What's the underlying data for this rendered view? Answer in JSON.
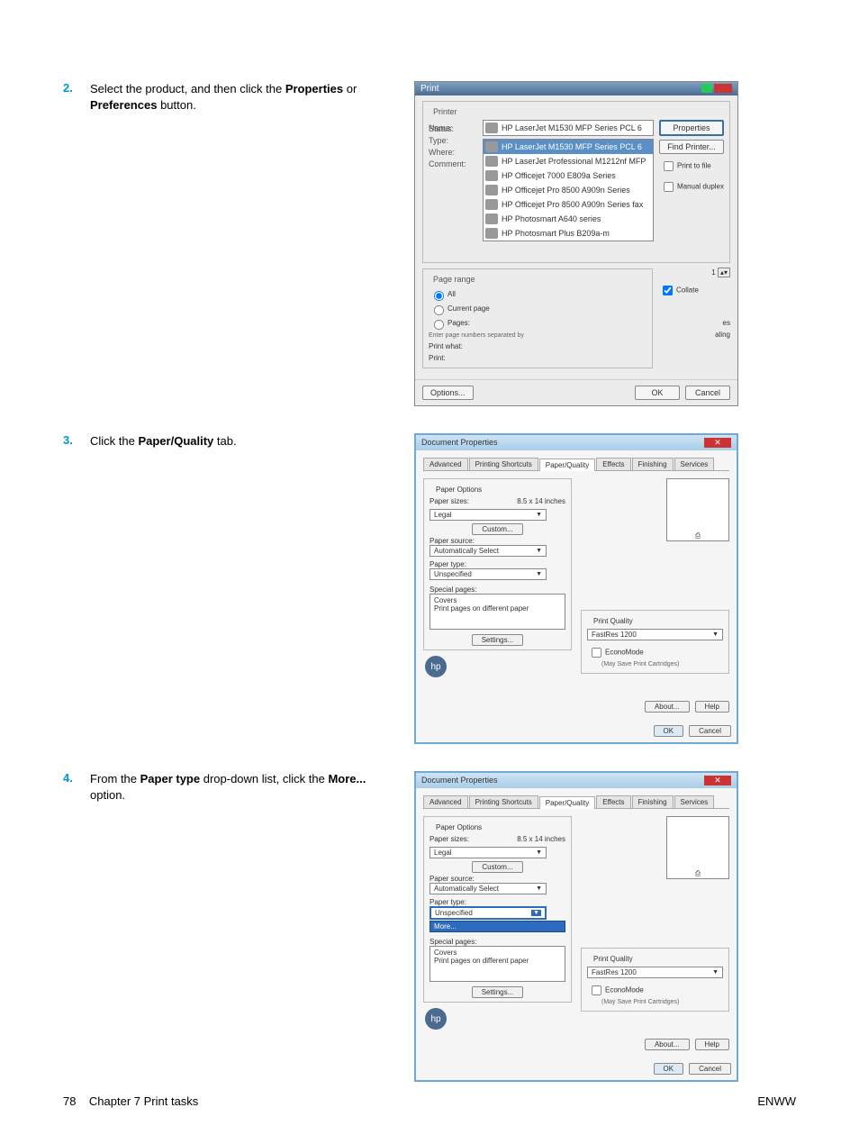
{
  "steps": {
    "s2": {
      "num": "2.",
      "text_pre": "Select the product, and then click the ",
      "bold1": "Properties",
      "mid": " or ",
      "bold2": "Preferences",
      "text_post": " button."
    },
    "s3": {
      "num": "3.",
      "text_pre": "Click the ",
      "bold1": "Paper/Quality",
      "text_post": " tab."
    },
    "s4": {
      "num": "4.",
      "text_pre": "From the ",
      "bold1": "Paper type",
      "mid": " drop-down list, click the ",
      "bold2": "More...",
      "text_post": " option."
    }
  },
  "print_dialog": {
    "title": "Print",
    "printer_group": "Printer",
    "name_label": "Name:",
    "status_label": "Status:",
    "type_label": "Type:",
    "where_label": "Where:",
    "comment_label": "Comment:",
    "printers": [
      "HP LaserJet M1530 MFP Series PCL 6",
      "HP LaserJet M1530 MFP Series PCL 6",
      "HP LaserJet Professional M1212nf MFP",
      "HP Officejet 7000 E809a Series",
      "HP Officejet Pro 8500 A909n Series",
      "HP Officejet Pro 8500 A909n Series fax",
      "HP Photosmart A640 series",
      "HP Photosmart Plus B209a-m"
    ],
    "btn_properties": "Properties",
    "btn_findprinter": "Find Printer...",
    "chk_printtofile": "Print to file",
    "chk_manualduplex": "Manual duplex",
    "pagerange_group": "Page range",
    "radio_all": "All",
    "radio_current": "Current page",
    "radio_pages": "Pages:",
    "enter_pages": "Enter page numbers separated by",
    "printwhat_label": "Print what:",
    "print_label": "Print:",
    "chk_collate": "Collate",
    "copies_suffix": "es",
    "scaling": "aling",
    "btn_options": "Options...",
    "btn_ok": "OK",
    "btn_cancel": "Cancel"
  },
  "doc_props": {
    "title": "Document Properties",
    "tabs": [
      "Advanced",
      "Printing Shortcuts",
      "Paper/Quality",
      "Effects",
      "Finishing",
      "Services"
    ],
    "paper_options": "Paper Options",
    "paper_sizes": "Paper sizes:",
    "size_dim": "8.5 x 14 inches",
    "size_val": "Legal",
    "btn_custom": "Custom...",
    "paper_source": "Paper source:",
    "source_val": "Automatically Select",
    "paper_type": "Paper type:",
    "type_val": "Unspecified",
    "more": "More...",
    "special_pages": "Special pages:",
    "list_covers": "Covers",
    "list_diff": "Print pages on different paper",
    "btn_settings": "Settings...",
    "print_quality": "Print Quality",
    "pq_val": "FastRes 1200",
    "economode": "EconoMode",
    "eco_sub": "(May Save Print Cartridges)",
    "btn_about": "About...",
    "btn_help": "Help",
    "btn_ok": "OK",
    "btn_cancel": "Cancel"
  },
  "footer": {
    "left_pre": "78",
    "left_mid": "Chapter 7   Print tasks",
    "right": "ENWW"
  }
}
